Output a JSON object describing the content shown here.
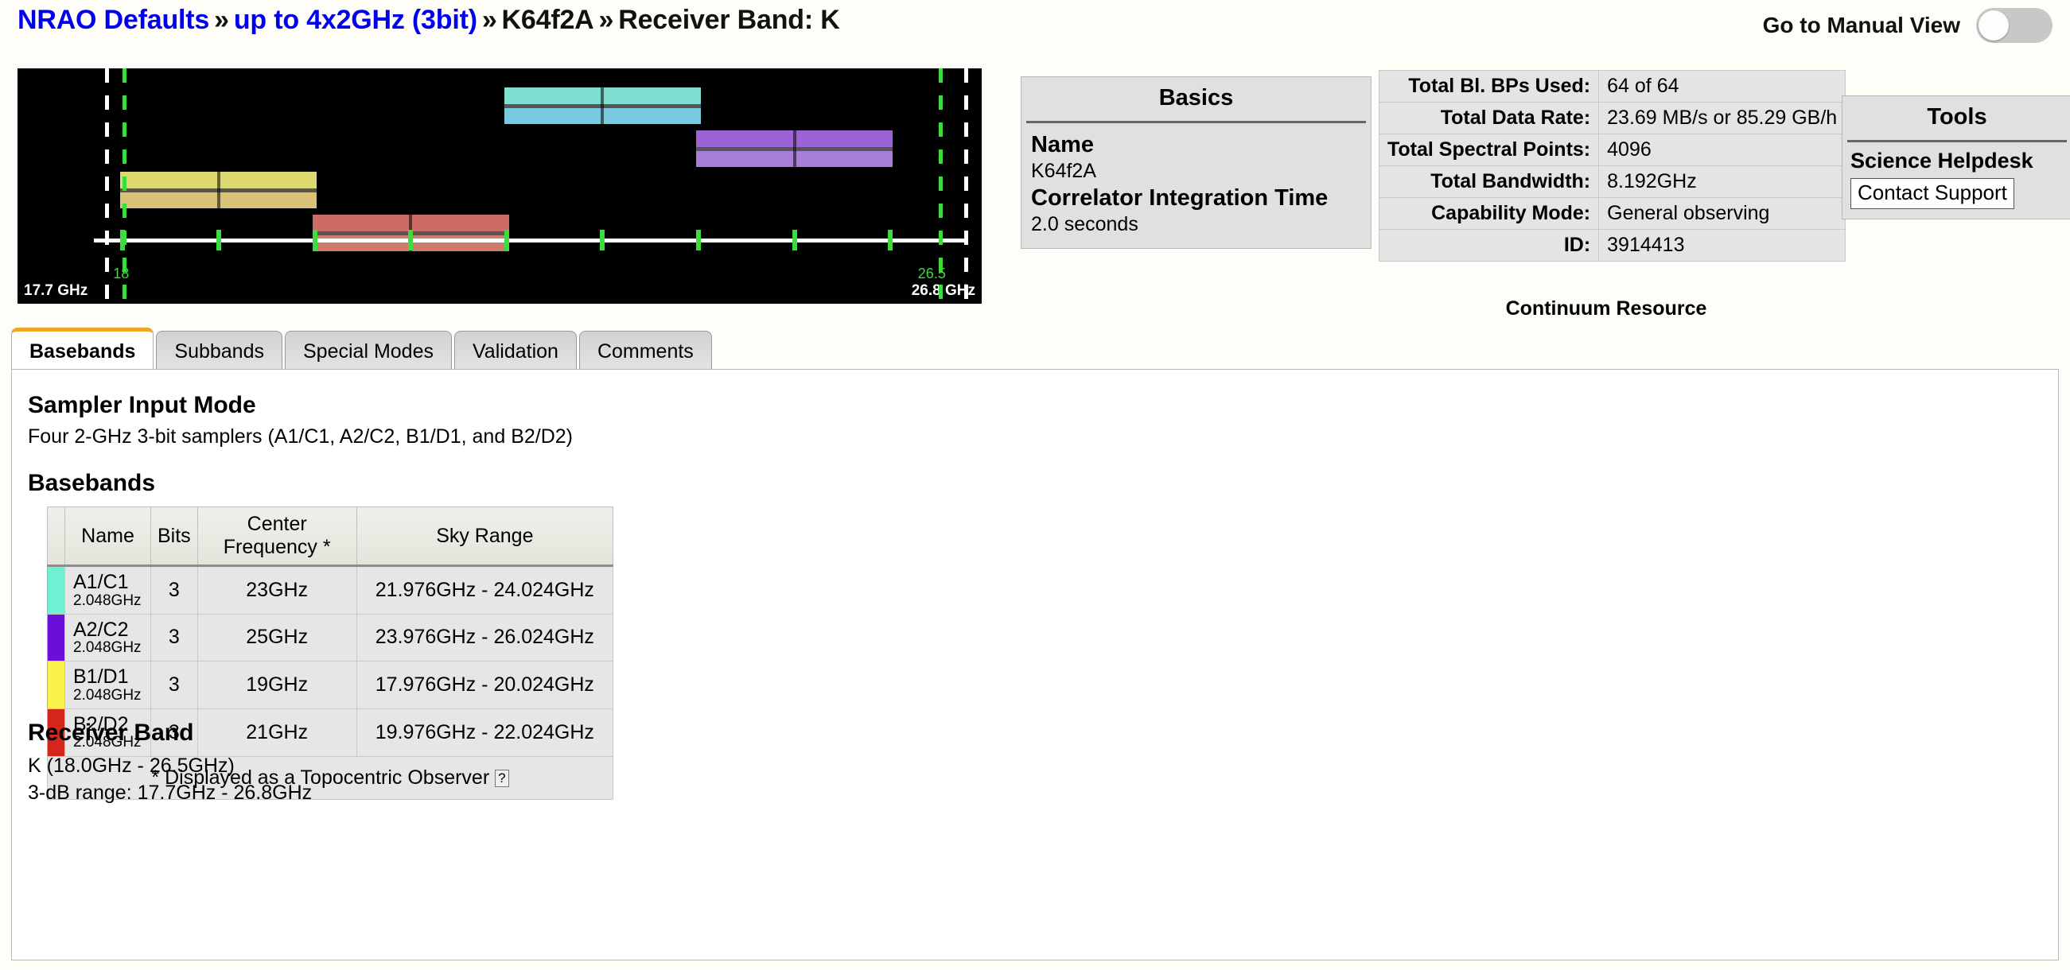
{
  "header": {
    "breadcrumb": [
      {
        "text": "NRAO Defaults",
        "link": true
      },
      {
        "text": "»",
        "sep": true
      },
      {
        "text": "up to 4x2GHz (3bit)",
        "link": true
      },
      {
        "text": "»",
        "sep": true
      },
      {
        "text": "K64f2A",
        "link": false
      },
      {
        "text": "»",
        "sep": true
      },
      {
        "text": "Receiver Band: K",
        "link": false
      }
    ],
    "manual_view_label": "Go to Manual View",
    "toggle_state": "off"
  },
  "spectrum": {
    "left_label": "17.7 GHz",
    "right_label": "26.8 GHz",
    "green_left_label": "18",
    "green_right_label": "26.5",
    "axis_min": 17.7,
    "axis_max": 26.8,
    "band_min": 18.0,
    "band_max": 26.5,
    "background": "#000000",
    "bands": [
      {
        "name": "A1/C1",
        "lo": 21.976,
        "hi": 24.024,
        "center": 23,
        "top_color": "#7fdfd0",
        "bottom_color": "#79c9e0",
        "row": 0
      },
      {
        "name": "A2/C2",
        "lo": 23.976,
        "hi": 26.024,
        "center": 25,
        "top_color": "#9b63d3",
        "bottom_color": "#a87fd8",
        "row": 1
      },
      {
        "name": "B1/D1",
        "lo": 17.976,
        "hi": 20.024,
        "center": 19,
        "top_color": "#dcda6e",
        "bottom_color": "#d9c277",
        "row": 2
      },
      {
        "name": "B2/D2",
        "lo": 19.976,
        "hi": 22.024,
        "center": 21,
        "top_color": "#cd6c62",
        "bottom_color": "#cf7b6c",
        "row": 3
      }
    ],
    "ticks": [
      18,
      19,
      20,
      21,
      22,
      23,
      24,
      25,
      26
    ]
  },
  "basics": {
    "title": "Basics",
    "name_label": "Name",
    "name_value": "K64f2A",
    "cit_label": "Correlator Integration Time",
    "cit_value": "2.0 seconds"
  },
  "summary": {
    "rows": [
      {
        "label": "Total Bl. BPs Used:",
        "value": "64 of 64"
      },
      {
        "label": "Total Data Rate:",
        "value": "23.69 MB/s or 85.29 GB/h"
      },
      {
        "label": "Total Spectral Points:",
        "value": "4096"
      },
      {
        "label": "Total Bandwidth:",
        "value": "8.192GHz"
      },
      {
        "label": "Capability Mode:",
        "value": "General observing"
      },
      {
        "label": "ID:",
        "value": "3914413"
      }
    ],
    "caption": "Continuum Resource"
  },
  "tools": {
    "title": "Tools",
    "helpdesk_label": "Science Helpdesk",
    "contact_button": "Contact Support"
  },
  "tabs": [
    {
      "label": "Basebands",
      "active": true
    },
    {
      "label": "Subbands",
      "active": false
    },
    {
      "label": "Special Modes",
      "active": false
    },
    {
      "label": "Validation",
      "active": false
    },
    {
      "label": "Comments",
      "active": false
    }
  ],
  "panel": {
    "sampler_heading": "Sampler Input Mode",
    "sampler_desc": "Four 2-GHz 3-bit samplers (A1/C1, A2/C2, B1/D1, and B2/D2)",
    "basebands_heading": "Basebands",
    "table": {
      "headers": [
        "",
        "Name",
        "Bits",
        "Center Frequency *",
        "Sky Range"
      ],
      "rows": [
        {
          "swatch": "#6ff0d2",
          "name": "A1/C1",
          "bandwidth": "2.048GHz",
          "bits": "3",
          "center": "23GHz",
          "sky": "21.976GHz - 24.024GHz"
        },
        {
          "swatch": "#6a0fd9",
          "name": "A2/C2",
          "bandwidth": "2.048GHz",
          "bits": "3",
          "center": "25GHz",
          "sky": "23.976GHz - 26.024GHz"
        },
        {
          "swatch": "#fbf24b",
          "name": "B1/D1",
          "bandwidth": "2.048GHz",
          "bits": "3",
          "center": "19GHz",
          "sky": "17.976GHz - 20.024GHz"
        },
        {
          "swatch": "#d4261c",
          "name": "B2/D2",
          "bandwidth": "2.048GHz",
          "bits": "3",
          "center": "21GHz",
          "sky": "19.976GHz - 22.024GHz"
        }
      ],
      "footnote": "* Displayed as a Topocentric Observer",
      "footnote_help": "?"
    },
    "receiver_heading": "Receiver Band",
    "receiver_line1": "K (18.0GHz - 26.5GHz)",
    "receiver_line2": "3-dB range: 17.7GHz - 26.8GHz"
  }
}
